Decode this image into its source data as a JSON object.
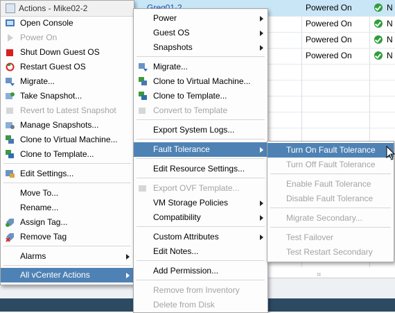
{
  "grid": {
    "selected_vm": "Greg01-2",
    "rows": [
      {
        "status": "Powered On",
        "health": "N"
      },
      {
        "status": "Powered On",
        "health": "N"
      },
      {
        "status": "Powered On",
        "health": "N"
      },
      {
        "status": "Powered On",
        "health": "N"
      }
    ]
  },
  "actions_menu": {
    "title": "Actions - Mike02-2",
    "items": [
      {
        "label": "Open Console",
        "icon": "console-icon"
      },
      {
        "label": "Power On",
        "icon": "power-on-icon",
        "disabled": true
      },
      {
        "label": "Shut Down Guest OS",
        "icon": "shutdown-icon"
      },
      {
        "label": "Restart Guest OS",
        "icon": "restart-icon"
      },
      {
        "label": "Migrate...",
        "icon": "migrate-icon"
      },
      {
        "label": "Take Snapshot...",
        "icon": "snapshot-icon"
      },
      {
        "label": "Revert to Latest Snapshot",
        "icon": "revert-icon",
        "disabled": true
      },
      {
        "label": "Manage Snapshots...",
        "icon": "manage-snapshots-icon"
      },
      {
        "label": "Clone to Virtual Machine...",
        "icon": "clone-vm-icon"
      },
      {
        "label": "Clone to Template...",
        "icon": "clone-template-icon"
      },
      {
        "label": "Edit Settings...",
        "icon": "edit-settings-icon"
      },
      {
        "label": "Move To...",
        "icon": ""
      },
      {
        "label": "Rename...",
        "icon": ""
      },
      {
        "label": "Assign Tag...",
        "icon": "assign-tag-icon"
      },
      {
        "label": "Remove Tag",
        "icon": "remove-tag-icon"
      },
      {
        "label": "Alarms",
        "icon": ""
      },
      {
        "label": "All vCenter Actions",
        "icon": ""
      }
    ]
  },
  "vcenter_menu": {
    "items": [
      {
        "label": "Power"
      },
      {
        "label": "Guest OS"
      },
      {
        "label": "Snapshots"
      },
      {
        "label": "Migrate..."
      },
      {
        "label": "Clone to Virtual Machine..."
      },
      {
        "label": "Clone to Template..."
      },
      {
        "label": "Convert to Template",
        "disabled": true
      },
      {
        "label": "Export System Logs..."
      },
      {
        "label": "Fault Tolerance"
      },
      {
        "label": "Edit Resource Settings..."
      },
      {
        "label": "Export OVF Template...",
        "disabled": true
      },
      {
        "label": "VM Storage Policies"
      },
      {
        "label": "Compatibility"
      },
      {
        "label": "Custom Attributes"
      },
      {
        "label": "Edit Notes..."
      },
      {
        "label": "Add Permission..."
      },
      {
        "label": "Remove from Inventory",
        "disabled": true
      },
      {
        "label": "Delete from Disk",
        "disabled": true
      }
    ]
  },
  "fault_tolerance_menu": {
    "items": [
      {
        "label": "Turn On Fault Tolerance"
      },
      {
        "label": "Turn Off Fault Tolerance",
        "disabled": true
      },
      {
        "label": "Enable Fault Tolerance",
        "disabled": true
      },
      {
        "label": "Disable Fault Tolerance",
        "disabled": true
      },
      {
        "label": "Migrate Secondary...",
        "disabled": true
      },
      {
        "label": "Test Failover",
        "disabled": true
      },
      {
        "label": "Test Restart Secondary",
        "disabled": true
      }
    ]
  },
  "colors": {
    "highlight": "#4f82b4",
    "selected_row": "#c9e6f6",
    "ok_green": "#2f9e3e"
  }
}
